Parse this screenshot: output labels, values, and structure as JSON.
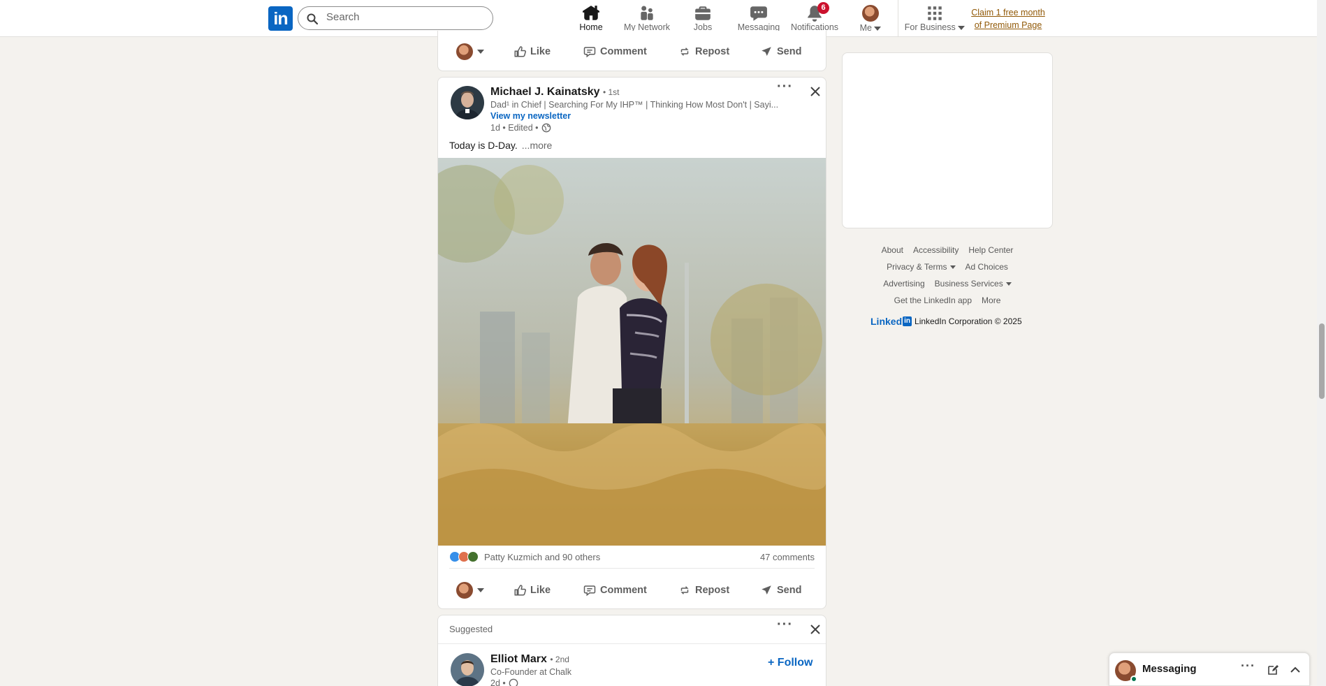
{
  "nav": {
    "search_placeholder": "Search",
    "items": [
      {
        "label": "Home"
      },
      {
        "label": "My Network"
      },
      {
        "label": "Jobs"
      },
      {
        "label": "Messaging"
      },
      {
        "label": "Notifications",
        "badge": "6"
      },
      {
        "label": "Me"
      },
      {
        "label": "For Business"
      }
    ],
    "premium_line1": "Claim 1 free month",
    "premium_line2": "of Premium Page"
  },
  "action_bar": {
    "like": "Like",
    "comment": "Comment",
    "repost": "Repost",
    "send": "Send"
  },
  "post": {
    "author_name": "Michael J. Kainatsky",
    "degree": "• 1st",
    "headline": "Dad¹ in Chief | Searching For My IHP™ | Thinking How Most Don't | Sayi...",
    "newsletter": "View my newsletter",
    "meta": "1d • Edited •",
    "text": "Today is D-Day.",
    "more": "...more",
    "reactions_text": "Patty Kuzmich and 90 others",
    "comments": "47 comments"
  },
  "suggested": {
    "label": "Suggested",
    "name": "Elliot Marx",
    "degree": "• 2nd",
    "headline": "Co-Founder at Chalk",
    "meta": "2d •",
    "follow": "+ Follow"
  },
  "footer": {
    "links_row1": [
      "About",
      "Accessibility",
      "Help Center"
    ],
    "privacy": "Privacy & Terms",
    "ad_choices": "Ad Choices",
    "advertising": "Advertising",
    "business_services": "Business Services",
    "get_app": "Get the LinkedIn app",
    "more": "More",
    "linkedin_word": "Linked",
    "linkedin_in": "in",
    "copyright": "LinkedIn Corporation © 2025"
  },
  "messaging": {
    "title": "Messaging"
  },
  "colors": {
    "brand": "#0a66c2",
    "badge": "#cb112d",
    "premium": "#915907",
    "background": "#f4f2ee"
  }
}
